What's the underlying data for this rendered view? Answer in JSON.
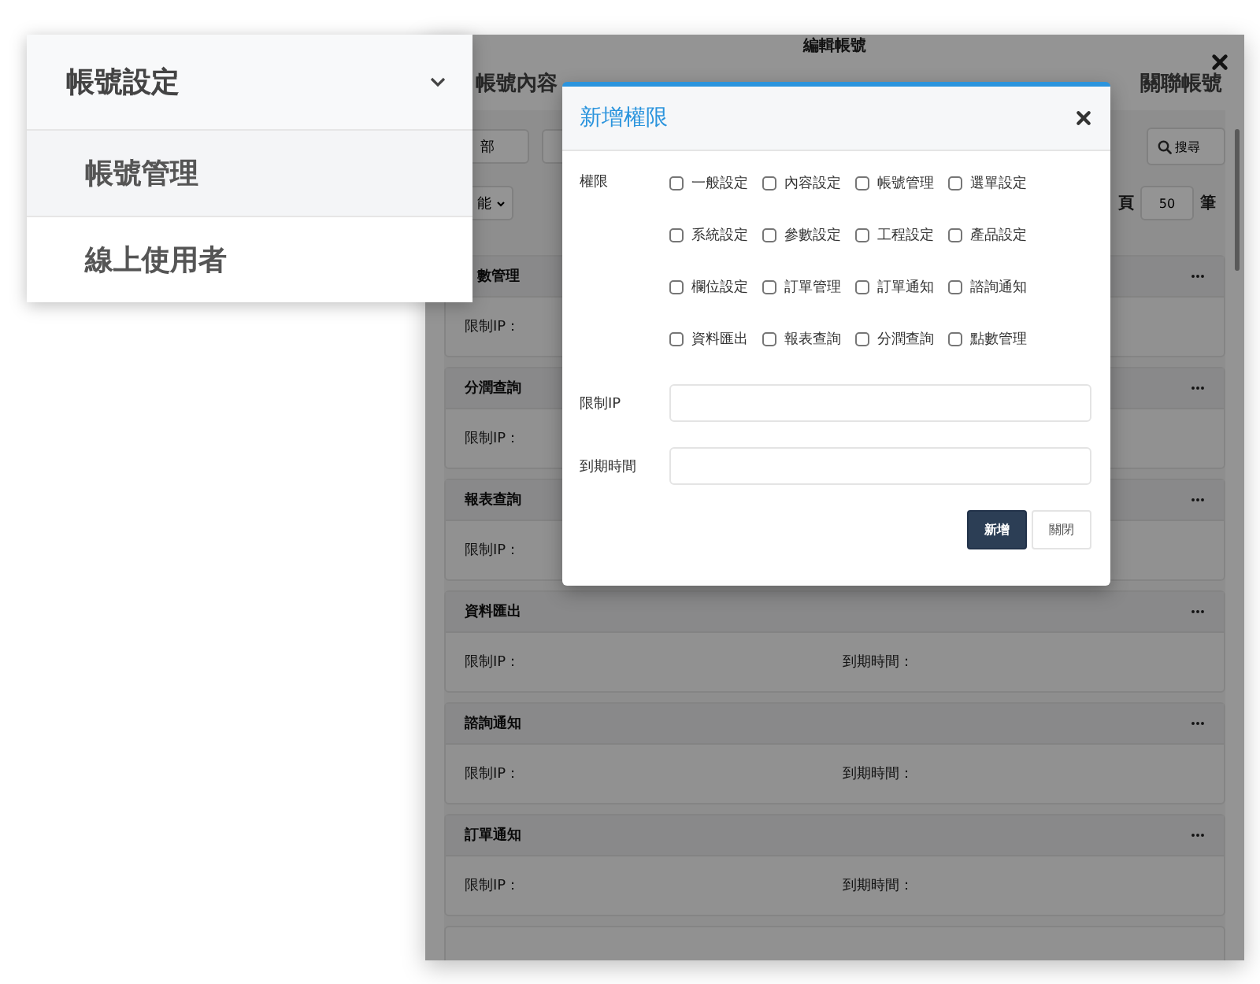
{
  "edit_window": {
    "title": "編輯帳號",
    "tabs": [
      {
        "label": "帳號內容"
      },
      {
        "label": "關聯帳號"
      }
    ],
    "filter": {
      "value": "部"
    },
    "search_button": "搜尋",
    "dropdown": "能",
    "page_size": {
      "prefix": "頁",
      "value": "50",
      "suffix": "筆"
    },
    "cards": [
      {
        "title": "數管理",
        "fields": [
          "限制IP："
        ]
      },
      {
        "title": "分潤查詢",
        "fields": [
          "限制IP："
        ]
      },
      {
        "title": "報表查詢",
        "fields": [
          "限制IP："
        ]
      },
      {
        "title": "資料匯出",
        "fields": [
          "限制IP：",
          "到期時間："
        ]
      },
      {
        "title": "諮詢通知",
        "fields": [
          "限制IP：",
          "到期時間："
        ]
      },
      {
        "title": "訂單通知",
        "fields": [
          "限制IP：",
          "到期時間："
        ]
      }
    ]
  },
  "side_menu": {
    "title": "帳號設定",
    "expanded": true,
    "items": [
      {
        "label": "帳號管理",
        "selected": true
      },
      {
        "label": "線上使用者",
        "selected": false
      }
    ]
  },
  "modal": {
    "title": "新增權限",
    "permission_label": "權限",
    "permissions": [
      {
        "label": "一般設定",
        "checked": false
      },
      {
        "label": "內容設定",
        "checked": false
      },
      {
        "label": "帳號管理",
        "checked": false
      },
      {
        "label": "選單設定",
        "checked": false
      },
      {
        "label": "系統設定",
        "checked": false
      },
      {
        "label": "參數設定",
        "checked": false
      },
      {
        "label": "工程設定",
        "checked": false
      },
      {
        "label": "產品設定",
        "checked": false
      },
      {
        "label": "欄位設定",
        "checked": false
      },
      {
        "label": "訂單管理",
        "checked": false
      },
      {
        "label": "訂單通知",
        "checked": false
      },
      {
        "label": "諮詢通知",
        "checked": false
      },
      {
        "label": "資料匯出",
        "checked": false
      },
      {
        "label": "報表查詢",
        "checked": false
      },
      {
        "label": "分潤查詢",
        "checked": false
      },
      {
        "label": "點數管理",
        "checked": false
      }
    ],
    "fields": [
      {
        "label": "限制IP"
      },
      {
        "label": "到期時間"
      }
    ],
    "buttons": [
      {
        "label": "新增",
        "kind": "primary"
      },
      {
        "label": "關閉",
        "kind": "default"
      }
    ]
  }
}
